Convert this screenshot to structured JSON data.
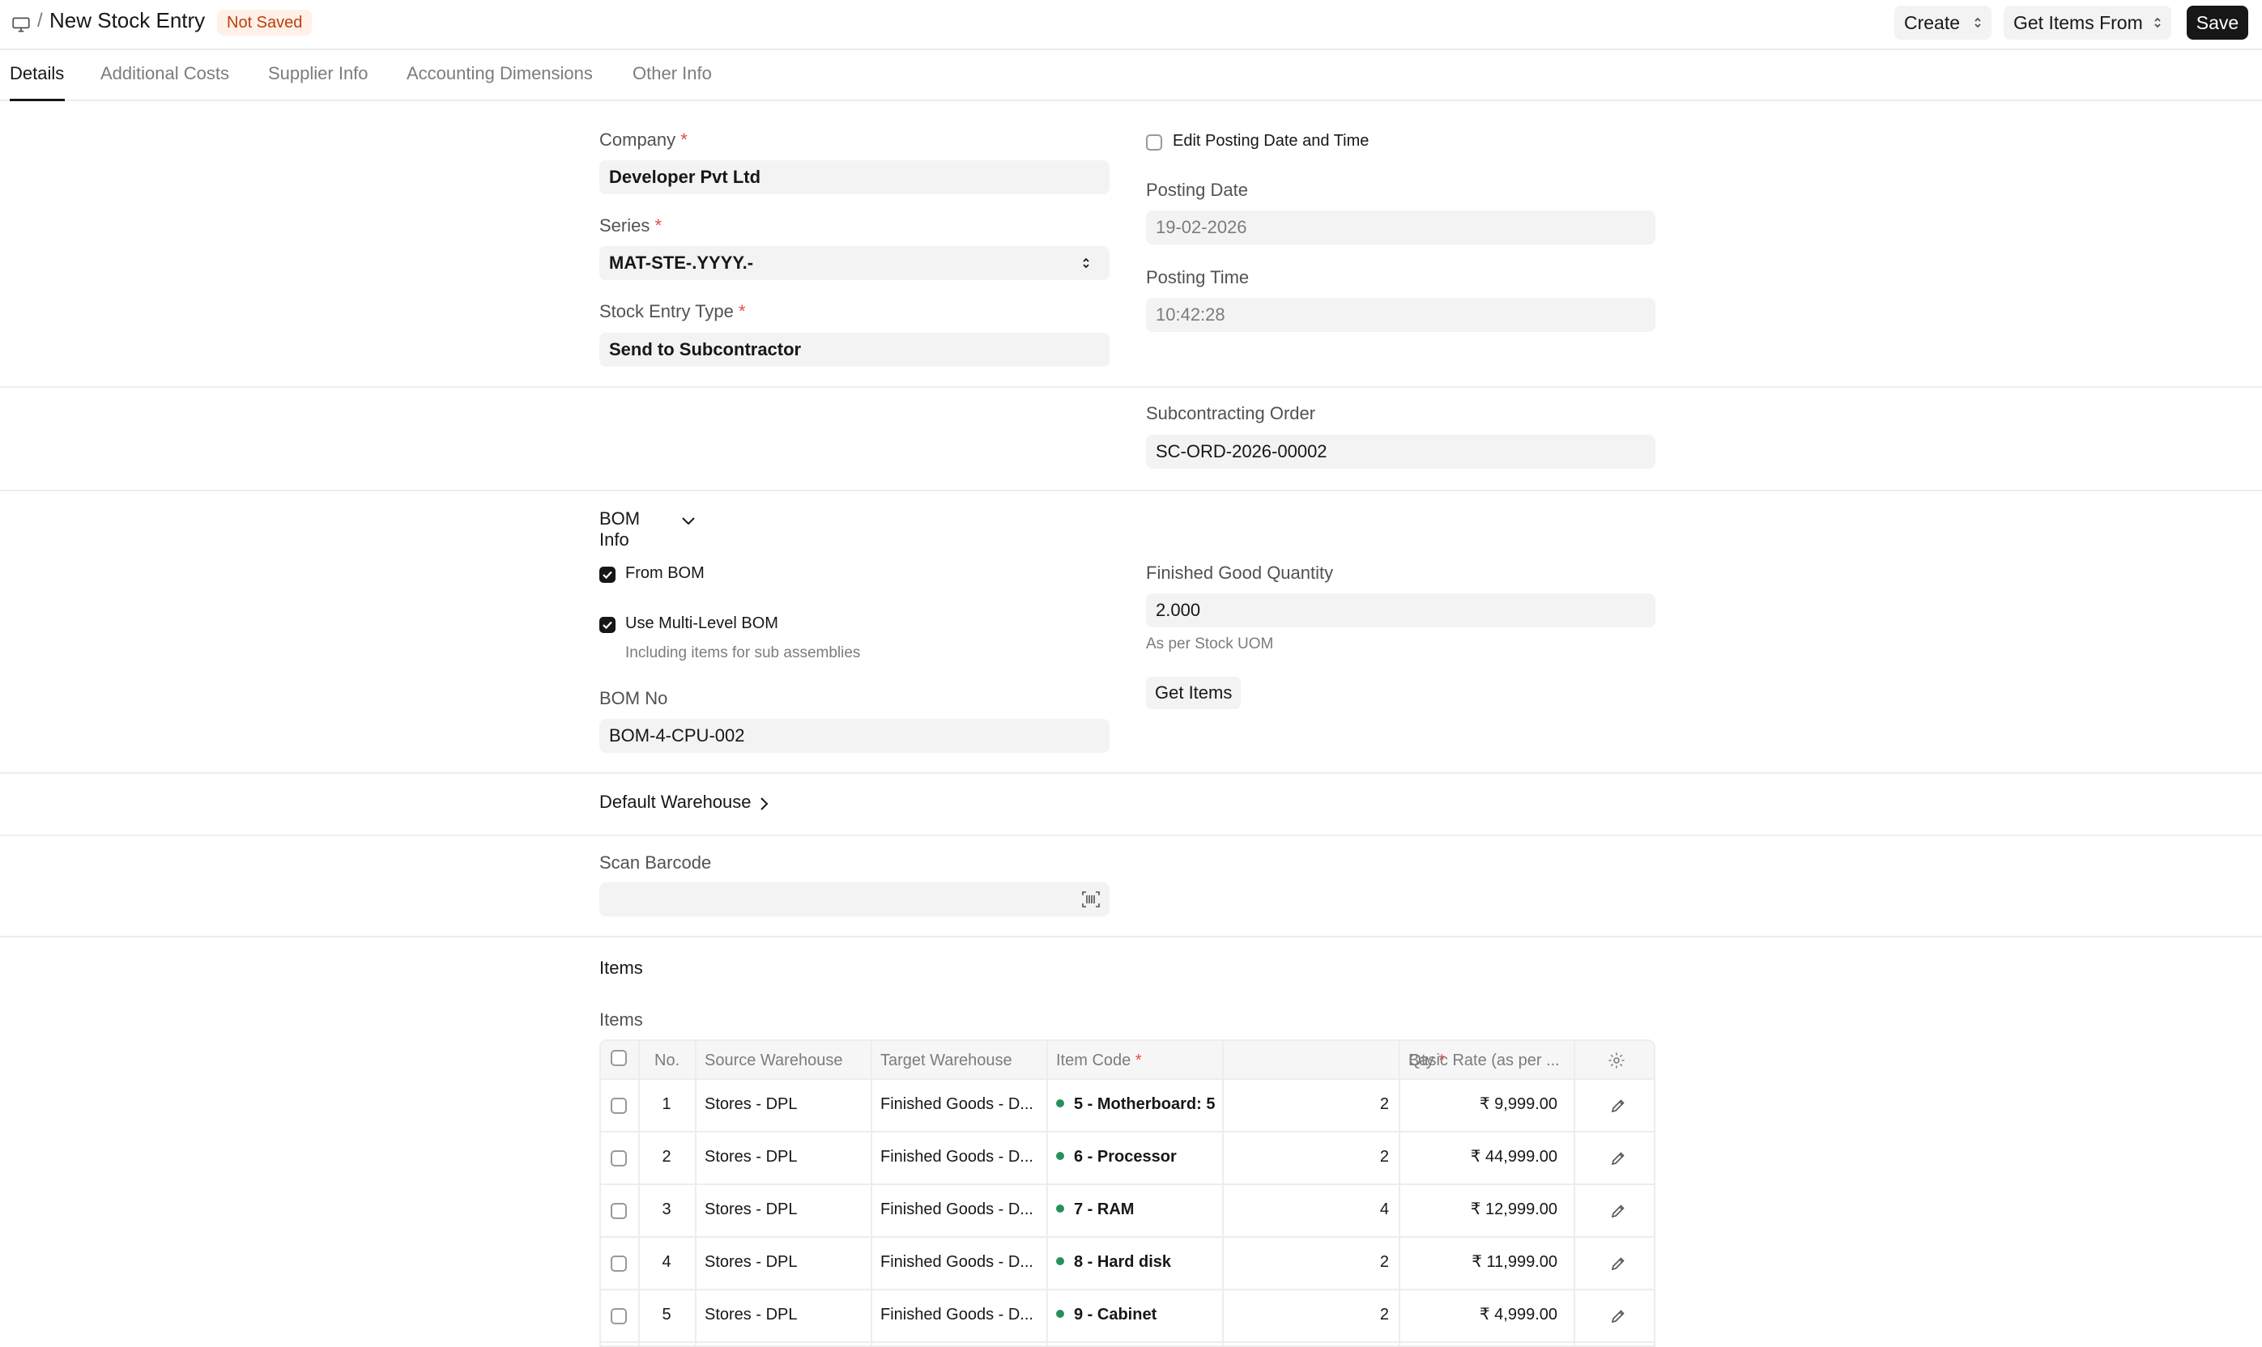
{
  "header": {
    "breadcrumb_sep": "/",
    "title": "New Stock Entry",
    "status": "Not Saved",
    "create_label": "Create",
    "get_items_from_label": "Get Items From",
    "save_label": "Save"
  },
  "tabs": [
    "Details",
    "Additional Costs",
    "Supplier Info",
    "Accounting Dimensions",
    "Other Info"
  ],
  "form": {
    "company_label": "Company",
    "company_value": "Developer Pvt Ltd",
    "series_label": "Series",
    "series_value": "MAT-STE-.YYYY.-",
    "entry_type_label": "Stock Entry Type",
    "entry_type_value": "Send to Subcontractor",
    "edit_posting_label": "Edit Posting Date and Time",
    "edit_posting_checked": false,
    "posting_date_label": "Posting Date",
    "posting_date_value": "19-02-2026",
    "posting_time_label": "Posting Time",
    "posting_time_value": "10:42:28",
    "required_mark": "*"
  },
  "subcontracting": {
    "label": "Subcontracting Order",
    "value": "SC-ORD-2026-00002"
  },
  "bom": {
    "section_title": "BOM Info",
    "from_bom_label": "From BOM",
    "from_bom_checked": true,
    "multi_level_label": "Use Multi-Level BOM",
    "multi_level_checked": true,
    "multi_level_desc": "Including items for sub assemblies",
    "bom_no_label": "BOM No",
    "bom_no_value": "BOM-4-CPU-002",
    "fg_qty_label": "Finished Good Quantity",
    "fg_qty_value": "2.000",
    "fg_qty_desc": "As per Stock UOM",
    "get_items_label": "Get Items"
  },
  "default_warehouse": {
    "section_title": "Default Warehouse"
  },
  "scan": {
    "label": "Scan Barcode",
    "value": ""
  },
  "items": {
    "section_title": "Items",
    "table_label": "Items",
    "columns": {
      "no": "No.",
      "source": "Source Warehouse",
      "target": "Target Warehouse",
      "item_code": "Item Code",
      "qty": "Qty",
      "rate": "Basic Rate (as per ..."
    },
    "rows": [
      {
        "no": "1",
        "source": "Stores - DPL",
        "target": "Finished Goods - D...",
        "item_code": "5 - Motherboard: 5",
        "qty": "2",
        "rate": "₹ 9,999.00"
      },
      {
        "no": "2",
        "source": "Stores - DPL",
        "target": "Finished Goods - D...",
        "item_code": "6 - Processor",
        "qty": "2",
        "rate": "₹ 44,999.00"
      },
      {
        "no": "3",
        "source": "Stores - DPL",
        "target": "Finished Goods - D...",
        "item_code": "7 - RAM",
        "qty": "4",
        "rate": "₹ 12,999.00"
      },
      {
        "no": "4",
        "source": "Stores - DPL",
        "target": "Finished Goods - D...",
        "item_code": "8 - Hard disk",
        "qty": "2",
        "rate": "₹ 11,999.00"
      },
      {
        "no": "5",
        "source": "Stores - DPL",
        "target": "Finished Goods - D...",
        "item_code": "9 - Cabinet",
        "qty": "2",
        "rate": "₹ 4,999.00"
      }
    ]
  },
  "icons": {
    "desk": "monitor-icon",
    "updown": "chevron-updown-icon",
    "chevron_down": "chevron-down-icon",
    "chevron_right": "chevron-right-icon",
    "barcode": "barcode-icon",
    "settings": "gear-icon",
    "edit": "pencil-icon"
  }
}
